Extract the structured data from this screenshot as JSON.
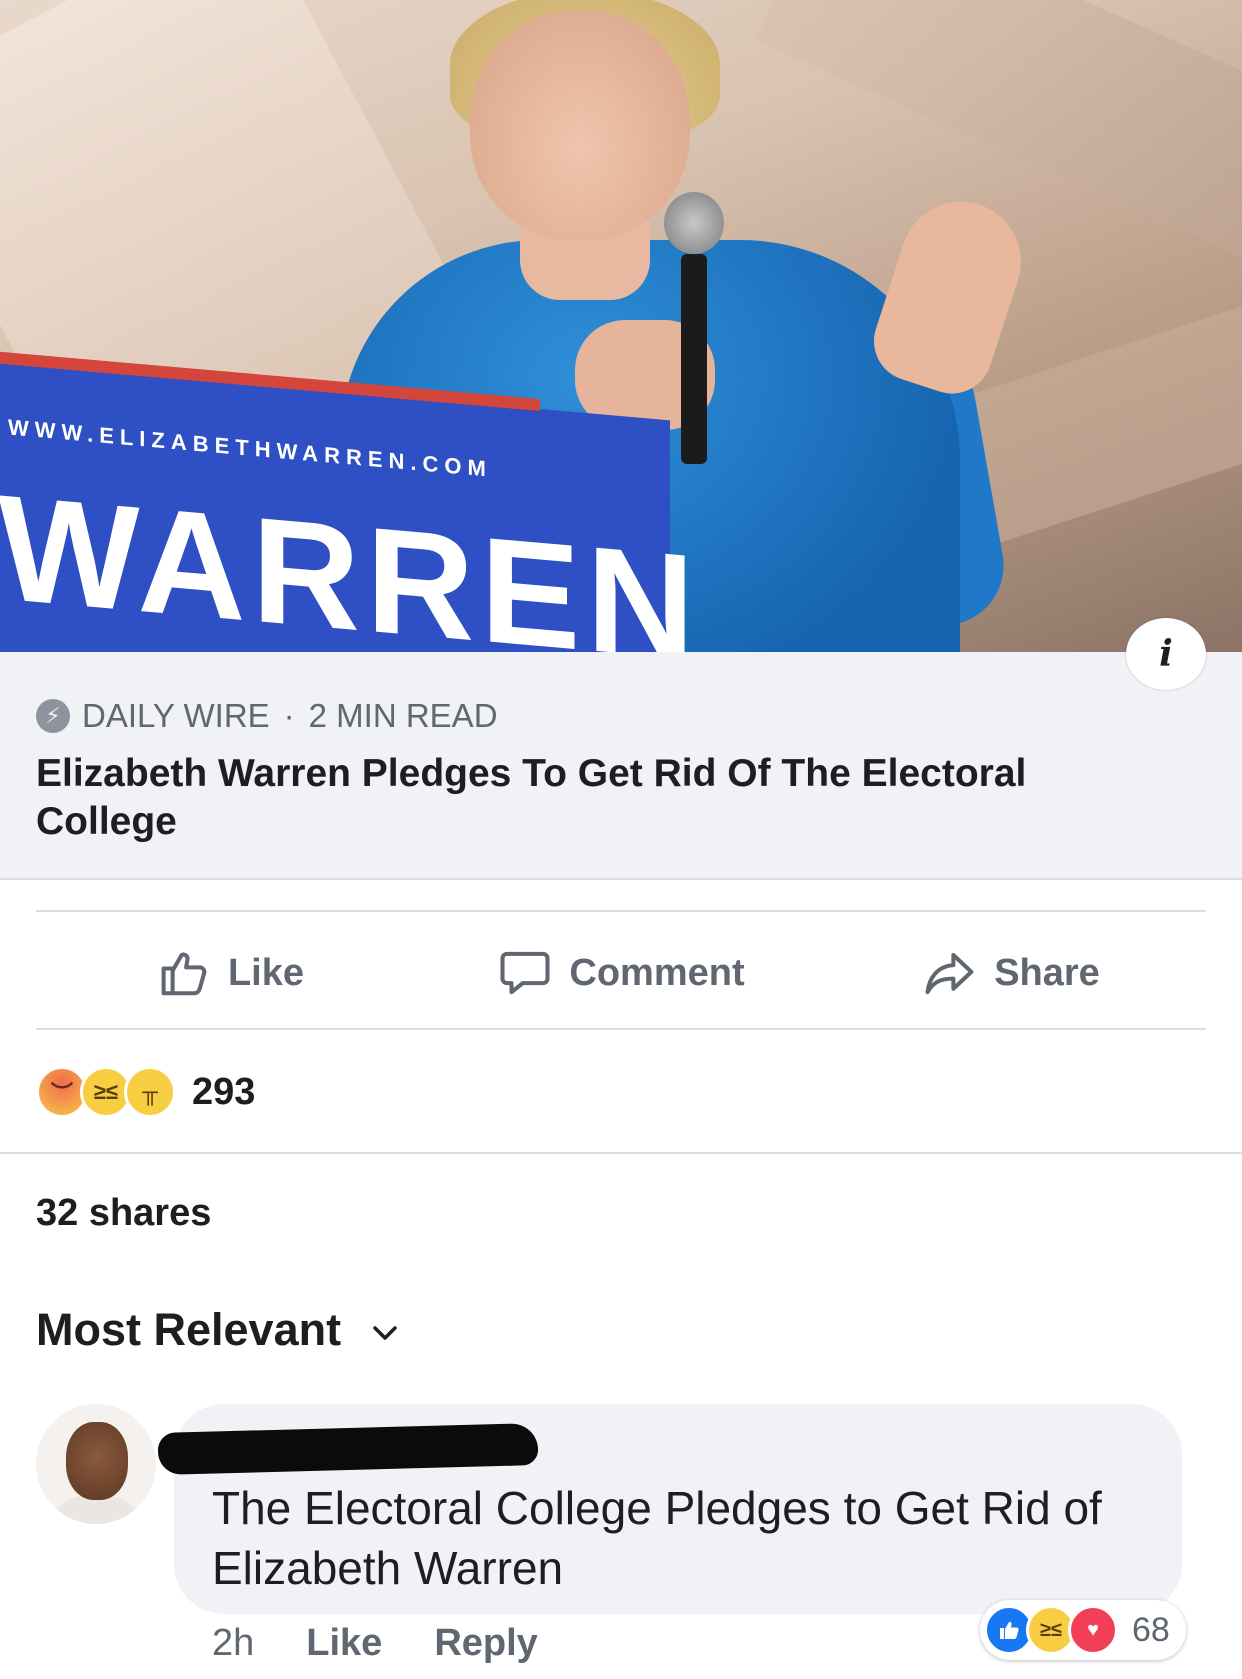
{
  "hero": {
    "podium_url": "WWW.ELIZABETHWARREN.COM",
    "podium_brand": "WARREN",
    "info_label": "i"
  },
  "link": {
    "source": "DAILY WIRE",
    "separator": "·",
    "read_time": "2 MIN READ",
    "headline": "Elizabeth Warren Pledges To Get Rid Of The Electoral College"
  },
  "actions": {
    "like_label": "Like",
    "comment_label": "Comment",
    "share_label": "Share"
  },
  "reactions": {
    "types": [
      "angry",
      "haha",
      "sad"
    ],
    "count": "293"
  },
  "shares_text": "32 shares",
  "sort": {
    "label": "Most Relevant"
  },
  "comment": {
    "author_name_redacted": true,
    "text": "The Electoral College Pledges to Get Rid of Elizabeth Warren",
    "time": "2h",
    "like_label": "Like",
    "reply_label": "Reply",
    "reaction_types": [
      "like",
      "haha",
      "love"
    ],
    "reaction_count": "68"
  },
  "colors": {
    "link_bg": "#f0f2f5",
    "muted_text": "#606770",
    "like_blue": "#1877f2",
    "love_red": "#f33e58",
    "podium_blue": "#2f4fc4"
  }
}
